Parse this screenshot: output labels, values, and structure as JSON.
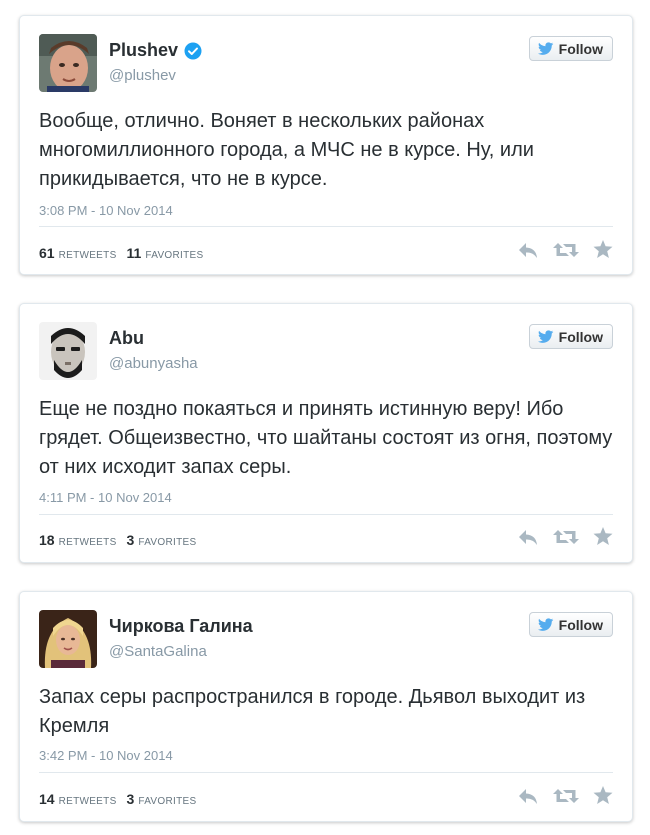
{
  "tweets": [
    {
      "name": "Plushev",
      "verified": true,
      "handle": "@plushev",
      "follow_label": "Follow",
      "text": "Вообще, отлично. Воняет  в нескольких районах многомиллионного города, а МЧС не в курсе. Ну, или прикидывается, что не в курсе.",
      "time": "3:08 PM - 10 Nov 2014",
      "retweets": "61",
      "retweets_label": "RETWEETS",
      "favorites": "11",
      "favorites_label": "FAVORITES"
    },
    {
      "name": "Abu",
      "verified": false,
      "handle": "@abunyasha",
      "follow_label": "Follow",
      "text": "Еще не поздно покаяться и принять истинную веру! Ибо грядет. Общеизвестно, что шайтаны состоят из огня, поэтому от них исходит запах серы.",
      "time": "4:11 PM - 10 Nov 2014",
      "retweets": "18",
      "retweets_label": "RETWEETS",
      "favorites": "3",
      "favorites_label": "FAVORITES"
    },
    {
      "name": "Чиркова Галина",
      "verified": false,
      "handle": "@SantaGalina",
      "follow_label": "Follow",
      "text": "Запах серы распространился в городе. Дьявол выходит из Кремля",
      "time": "3:42 PM - 10 Nov 2014",
      "retweets": "14",
      "retweets_label": "RETWEETS",
      "favorites": "3",
      "favorites_label": "FAVORITES"
    }
  ],
  "icons": {
    "follow": "twitter-bird-icon",
    "verified": "verified-badge-icon",
    "reply": "reply-icon",
    "retweet": "retweet-icon",
    "favorite": "star-icon"
  },
  "colors": {
    "twitter_blue": "#55acee",
    "verified_blue": "#1da1f2",
    "icon_gray": "#aab8c2"
  }
}
